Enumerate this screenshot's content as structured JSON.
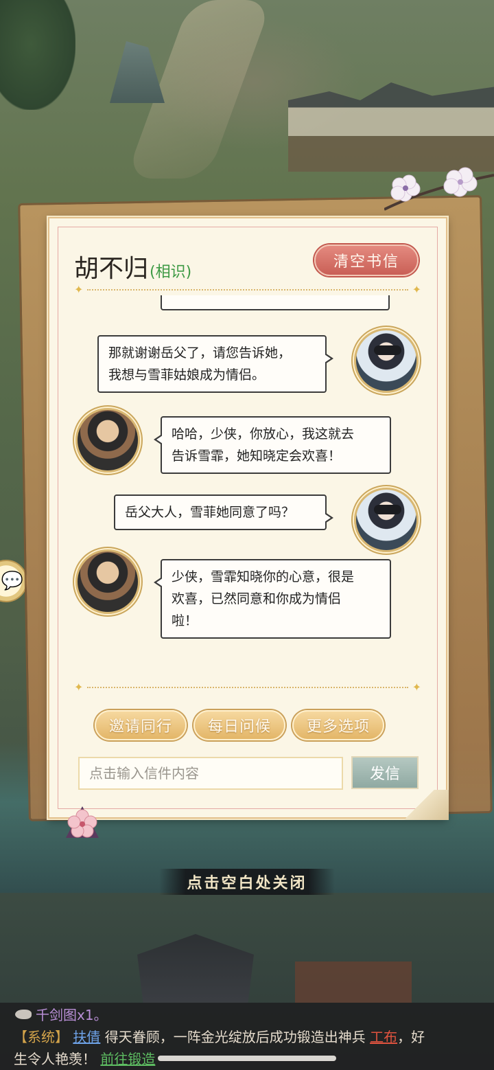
{
  "letter": {
    "contact_name": "胡不归",
    "relation": "(相识)",
    "clear_button": "清空书信"
  },
  "messages": [
    {
      "sender": "player",
      "avatar_icon": "masked-hero-avatar",
      "text_lines": [
        "那就谢谢岳父了，请您告诉她，",
        "我想与雪菲姑娘成为情侣。"
      ]
    },
    {
      "sender": "npc",
      "avatar_icon": "bearded-swordsman-avatar",
      "text_lines": [
        "哈哈，少侠，你放心，我这就去",
        "告诉雪霏，她知晓定会欢喜！"
      ]
    },
    {
      "sender": "player",
      "avatar_icon": "masked-hero-avatar",
      "text_lines": [
        "岳父大人，雪菲她同意了吗？"
      ]
    },
    {
      "sender": "npc",
      "avatar_icon": "bearded-swordsman-avatar",
      "text_lines": [
        "少侠，雪霏知晓你的心意，很是",
        "欢喜，已然同意和你成为情侣",
        "啦！"
      ]
    }
  ],
  "actions": {
    "invite": "邀请同行",
    "greet": "每日问候",
    "more": "更多选项"
  },
  "compose": {
    "placeholder": "点击输入信件内容",
    "send_button": "发信"
  },
  "close_hint": "点击空白处关闭",
  "system_log": {
    "prev_line": "千剑图x1。",
    "tag": "【系统】",
    "player_name": "扶倩",
    "text_before_item": "得天眷顾，一阵金光绽放后成功锻造出神兵",
    "item_name": "工布",
    "text_after_item": "，好",
    "line2_text": "生令人艳羡！",
    "goto_link": "前往锻造"
  },
  "colors": {
    "relation": "#3d9a44",
    "clear_button": "#c95f56",
    "system_tag": "#d2a34a",
    "player_link": "#6ea3e8",
    "item_link": "#e0533f",
    "goto_link": "#5ebd62"
  }
}
